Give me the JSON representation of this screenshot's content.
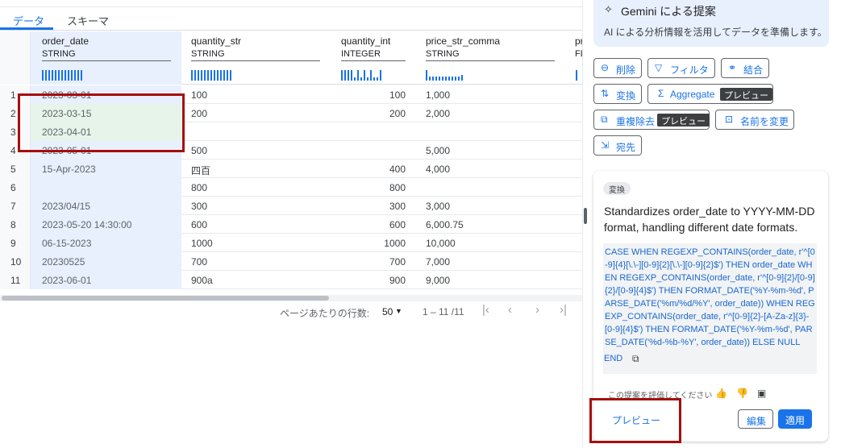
{
  "tabs": [
    {
      "label": "データ"
    },
    {
      "label": "スキーマ"
    }
  ],
  "columns": [
    {
      "name": "order_date",
      "type": "STRING"
    },
    {
      "name": "quantity_str",
      "type": "STRING"
    },
    {
      "name": "quantity_int",
      "type": "INTEGER"
    },
    {
      "name": "price_str_comma",
      "type": "STRING"
    },
    {
      "name": "pr",
      "type": "FL"
    }
  ],
  "rows": [
    {
      "n": "1",
      "order_date": "2023-03-01",
      "quantity_str": "100",
      "quantity_int": "100",
      "price_str_comma": "1,000"
    },
    {
      "n": "2",
      "order_date": "2023-03-15",
      "quantity_str": "200",
      "quantity_int": "200",
      "price_str_comma": "2,000"
    },
    {
      "n": "3",
      "order_date": "2023-04-01",
      "quantity_str": "",
      "quantity_int": "",
      "price_str_comma": ""
    },
    {
      "n": "4",
      "order_date": "2023-05-01",
      "quantity_str": "500",
      "quantity_int": "",
      "price_str_comma": "5,000"
    },
    {
      "n": "5",
      "order_date": "15-Apr-2023",
      "quantity_str": "四百",
      "quantity_int": "400",
      "price_str_comma": "4,000"
    },
    {
      "n": "6",
      "order_date": "",
      "quantity_str": "800",
      "quantity_int": "800",
      "price_str_comma": ""
    },
    {
      "n": "7",
      "order_date": "2023/04/15",
      "quantity_str": "300",
      "quantity_int": "300",
      "price_str_comma": "3,000"
    },
    {
      "n": "8",
      "order_date": "2023-05-20 14:30:00",
      "quantity_str": "600",
      "quantity_int": "600",
      "price_str_comma": "6,000.75"
    },
    {
      "n": "9",
      "order_date": "06-15-2023",
      "quantity_str": "1000",
      "quantity_int": "1000",
      "price_str_comma": "10,000"
    },
    {
      "n": "10",
      "order_date": "20230525",
      "quantity_str": "700",
      "quantity_int": "700",
      "price_str_comma": "7,000"
    },
    {
      "n": "11",
      "order_date": "2023-06-01",
      "quantity_str": "900a",
      "quantity_int": "900",
      "price_str_comma": "9,000"
    }
  ],
  "pager": {
    "rows_label": "ページあたりの行数:",
    "per_page": "50",
    "range": "1 – 11 /11"
  },
  "gemini": {
    "title": "Gemini による提案",
    "desc": "AI による分析情報を活用してデータを準備します。"
  },
  "actions": {
    "delete": "削除",
    "filter": "フィルタ",
    "join": "結合",
    "transform": "変換",
    "aggregate": "Aggregate",
    "dedupe": "重複除去",
    "rename": "名前を変更",
    "destination": "宛先",
    "preview_badge": "プレビュー"
  },
  "suggestion": {
    "tag": "変換",
    "text": "Standardizes order_date to YYYY-MM-DD format, handling different date formats.",
    "code": "CASE WHEN REGEXP_CONTAINS(order_date, r'^[0-9]{4}[\\.\\-][0-9]{2}[\\.\\-][0-9]{2}$') THEN order_date WHEN REGEXP_CONTAINS(order_date, r'^[0-9]{2}/[0-9]{2}/[0-9]{4}$') THEN FORMAT_DATE('%Y-%m-%d', PARSE_DATE('%m/%d/%Y', order_date)) WHEN REGEXP_CONTAINS(order_date, r'^[0-9]{2}-[A-Za-z]{3}-[0-9]{4}$') THEN FORMAT_DATE('%Y-%m-%d', PARSE_DATE('%d-%b-%Y', order_date)) ELSE NULL",
    "end": "END",
    "rate": "この提案を評価してください",
    "preview": "プレビュー",
    "edit": "編集",
    "apply": "適用"
  },
  "colors": {
    "accent": "#1a73e8",
    "highlight": "#a50e0e"
  }
}
